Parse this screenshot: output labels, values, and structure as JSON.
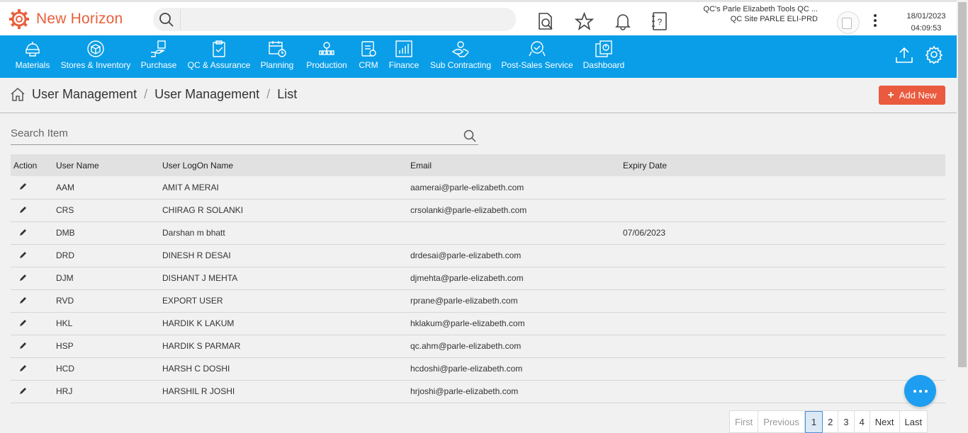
{
  "app": {
    "name": "New Horizon"
  },
  "header": {
    "company_line1": "QC's Parle Elizabeth Tools QC ...",
    "company_line2": "QC Site PARLE ELI-PRD",
    "date": "18/01/2023",
    "time": "04:09:53"
  },
  "nav": {
    "items": [
      {
        "label": "Materials",
        "icon": "materials-icon"
      },
      {
        "label": "Stores & Inventory",
        "icon": "stores-icon"
      },
      {
        "label": "Purchase",
        "icon": "purchase-icon"
      },
      {
        "label": "QC & Assurance",
        "icon": "qc-icon"
      },
      {
        "label": "Planning",
        "icon": "planning-icon"
      },
      {
        "label": "Production",
        "icon": "production-icon"
      },
      {
        "label": "CRM",
        "icon": "crm-icon"
      },
      {
        "label": "Finance",
        "icon": "finance-icon"
      },
      {
        "label": "Sub Contracting",
        "icon": "subcontracting-icon"
      },
      {
        "label": "Post-Sales Service",
        "icon": "post-sales-icon"
      },
      {
        "label": "Dashboard",
        "icon": "dashboard-icon"
      }
    ]
  },
  "breadcrumb": {
    "level1": "User Management",
    "level2": "User Management",
    "level3": "List",
    "sep": "/"
  },
  "add_new_label": "Add New",
  "search": {
    "placeholder": "Search Item"
  },
  "table": {
    "headers": {
      "action": "Action",
      "user_name": "User Name",
      "logon_name": "User LogOn Name",
      "email": "Email",
      "expiry": "Expiry Date"
    },
    "rows": [
      {
        "user_name": "AAM",
        "logon_name": "AMIT A MERAI",
        "email": "aamerai@parle-elizabeth.com",
        "expiry": ""
      },
      {
        "user_name": "CRS",
        "logon_name": "CHIRAG R SOLANKI",
        "email": "crsolanki@parle-elizabeth.com",
        "expiry": ""
      },
      {
        "user_name": "DMB",
        "logon_name": "Darshan m bhatt",
        "email": "",
        "expiry": "07/06/2023"
      },
      {
        "user_name": "DRD",
        "logon_name": "DINESH R DESAI",
        "email": "drdesai@parle-elizabeth.com",
        "expiry": ""
      },
      {
        "user_name": "DJM",
        "logon_name": "DISHANT J MEHTA",
        "email": "djmehta@parle-elizabeth.com",
        "expiry": ""
      },
      {
        "user_name": "RVD",
        "logon_name": "EXPORT USER",
        "email": "rprane@parle-elizabeth.com",
        "expiry": ""
      },
      {
        "user_name": "HKL",
        "logon_name": "HARDIK K LAKUM",
        "email": "hklakum@parle-elizabeth.com",
        "expiry": ""
      },
      {
        "user_name": "HSP",
        "logon_name": "HARDIK S PARMAR",
        "email": "qc.ahm@parle-elizabeth.com",
        "expiry": ""
      },
      {
        "user_name": "HCD",
        "logon_name": "HARSH C DOSHI",
        "email": "hcdoshi@parle-elizabeth.com",
        "expiry": ""
      },
      {
        "user_name": "HRJ",
        "logon_name": "HARSHIL R JOSHI",
        "email": "hrjoshi@parle-elizabeth.com",
        "expiry": ""
      }
    ]
  },
  "pager": {
    "first": "First",
    "previous": "Previous",
    "p1": "1",
    "p2": "2",
    "p3": "3",
    "p4": "4",
    "next": "Next",
    "last": "Last"
  },
  "colors": {
    "brand": "#e8603c",
    "nav": "#0a9ee8",
    "add_button": "#ea5a3e",
    "chat": "#1e9ef0"
  }
}
